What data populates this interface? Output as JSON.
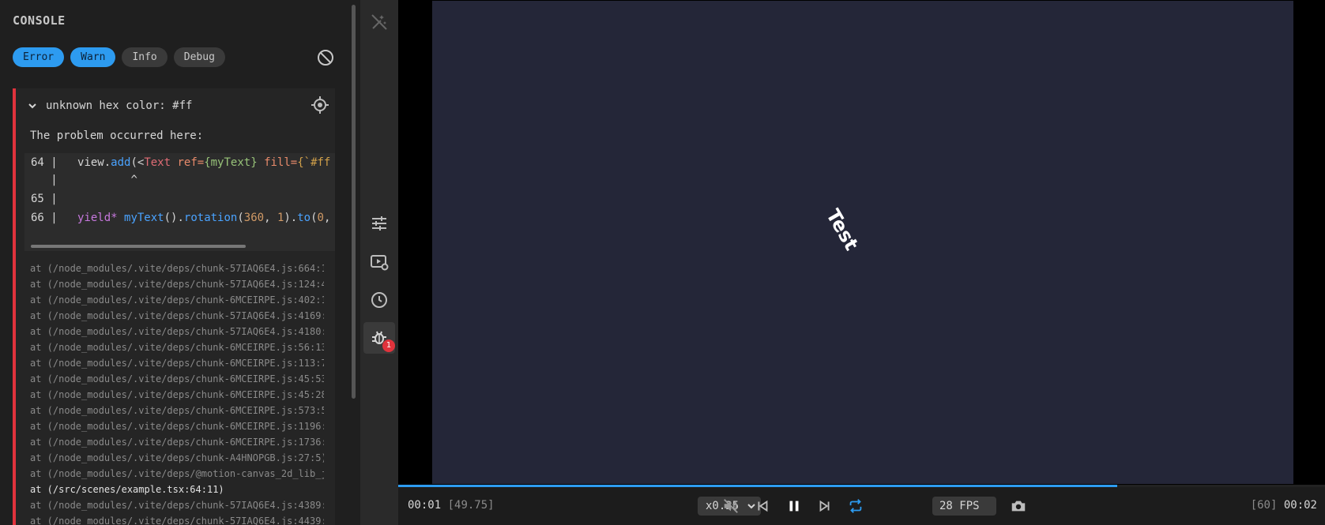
{
  "console": {
    "title": "CONSOLE",
    "filters": [
      {
        "label": "Error",
        "active": true
      },
      {
        "label": "Warn",
        "active": true
      },
      {
        "label": "Info",
        "active": false
      },
      {
        "label": "Debug",
        "active": false
      }
    ],
    "clear_icon": "block-icon",
    "error": {
      "message": "unknown hex color: #ff",
      "problem_text": "The problem occurred here:",
      "code": {
        "line64_num": "64 |",
        "line64_a": "view.",
        "line64_fn": "add",
        "line64_b": "(<",
        "line64_tag": "Text",
        "line64_attr1": " ref=",
        "line64_val1": "{myText}",
        "line64_attr2": " fill=",
        "line64_str": "{`#ff",
        "caret_num": "   |",
        "caret": "^",
        "line65_num": "65 |",
        "line66_num": "66 |",
        "line66_kw": "yield*",
        "line66_fn1": " myText",
        "line66_a": "().",
        "line66_fn2": "rotation",
        "line66_b": "(",
        "line66_n1": "360",
        "line66_c": ", ",
        "line66_n2": "1",
        "line66_d": ").",
        "line66_fn3": "to",
        "line66_e": "(",
        "line66_n3": "0",
        "line66_f": ","
      },
      "stack": [
        {
          "text": "at (/node_modules/.vite/deps/chunk-57IAQ6E4.js:664:1",
          "highlight": false
        },
        {
          "text": "at (/node_modules/.vite/deps/chunk-57IAQ6E4.js:124:4",
          "highlight": false
        },
        {
          "text": "at (/node_modules/.vite/deps/chunk-6MCEIRPE.js:402:1",
          "highlight": false
        },
        {
          "text": "at (/node_modules/.vite/deps/chunk-57IAQ6E4.js:4169:",
          "highlight": false
        },
        {
          "text": "at (/node_modules/.vite/deps/chunk-57IAQ6E4.js:4180:",
          "highlight": false
        },
        {
          "text": "at (/node_modules/.vite/deps/chunk-6MCEIRPE.js:56:13",
          "highlight": false
        },
        {
          "text": "at (/node_modules/.vite/deps/chunk-6MCEIRPE.js:113:7",
          "highlight": false
        },
        {
          "text": "at (/node_modules/.vite/deps/chunk-6MCEIRPE.js:45:53",
          "highlight": false
        },
        {
          "text": "at (/node_modules/.vite/deps/chunk-6MCEIRPE.js:45:28",
          "highlight": false
        },
        {
          "text": "at (/node_modules/.vite/deps/chunk-6MCEIRPE.js:573:5",
          "highlight": false
        },
        {
          "text": "at (/node_modules/.vite/deps/chunk-6MCEIRPE.js:1196:",
          "highlight": false
        },
        {
          "text": "at (/node_modules/.vite/deps/chunk-6MCEIRPE.js:1736:",
          "highlight": false
        },
        {
          "text": "at (/node_modules/.vite/deps/chunk-A4HNOPGB.js:27:5)",
          "highlight": false
        },
        {
          "text": "at (/node_modules/.vite/deps/@motion-canvas_2d_lib_j",
          "highlight": false
        },
        {
          "text": "at (/src/scenes/example.tsx:64:11)",
          "highlight": true
        },
        {
          "text": "at (/node_modules/.vite/deps/chunk-57IAQ6E4.js:4389:",
          "highlight": false
        },
        {
          "text": "at (/node_modules/.vite/deps/chunk-57IAQ6E4.js:4439:",
          "highlight": false
        }
      ]
    }
  },
  "sidebar": {
    "items": [
      {
        "icon": "magic-wand-off-icon",
        "active": false
      },
      {
        "icon": "sliders-icon",
        "active": false
      },
      {
        "icon": "video-settings-icon",
        "active": false
      },
      {
        "icon": "clock-icon",
        "active": false
      },
      {
        "icon": "bug-icon",
        "active": true
      }
    ],
    "debug_badge": "1"
  },
  "viewport": {
    "canvas_text": "Test",
    "canvas_color": "#242638",
    "text_rotation_deg": 60
  },
  "playback": {
    "progress": 0.776,
    "time_current": "00:01",
    "frame_current": "[49.75]",
    "speed": "x0.25",
    "fps": "28 FPS",
    "frame_total": "[60]",
    "time_total": "00:02",
    "accent_color": "#2d9bf0"
  }
}
